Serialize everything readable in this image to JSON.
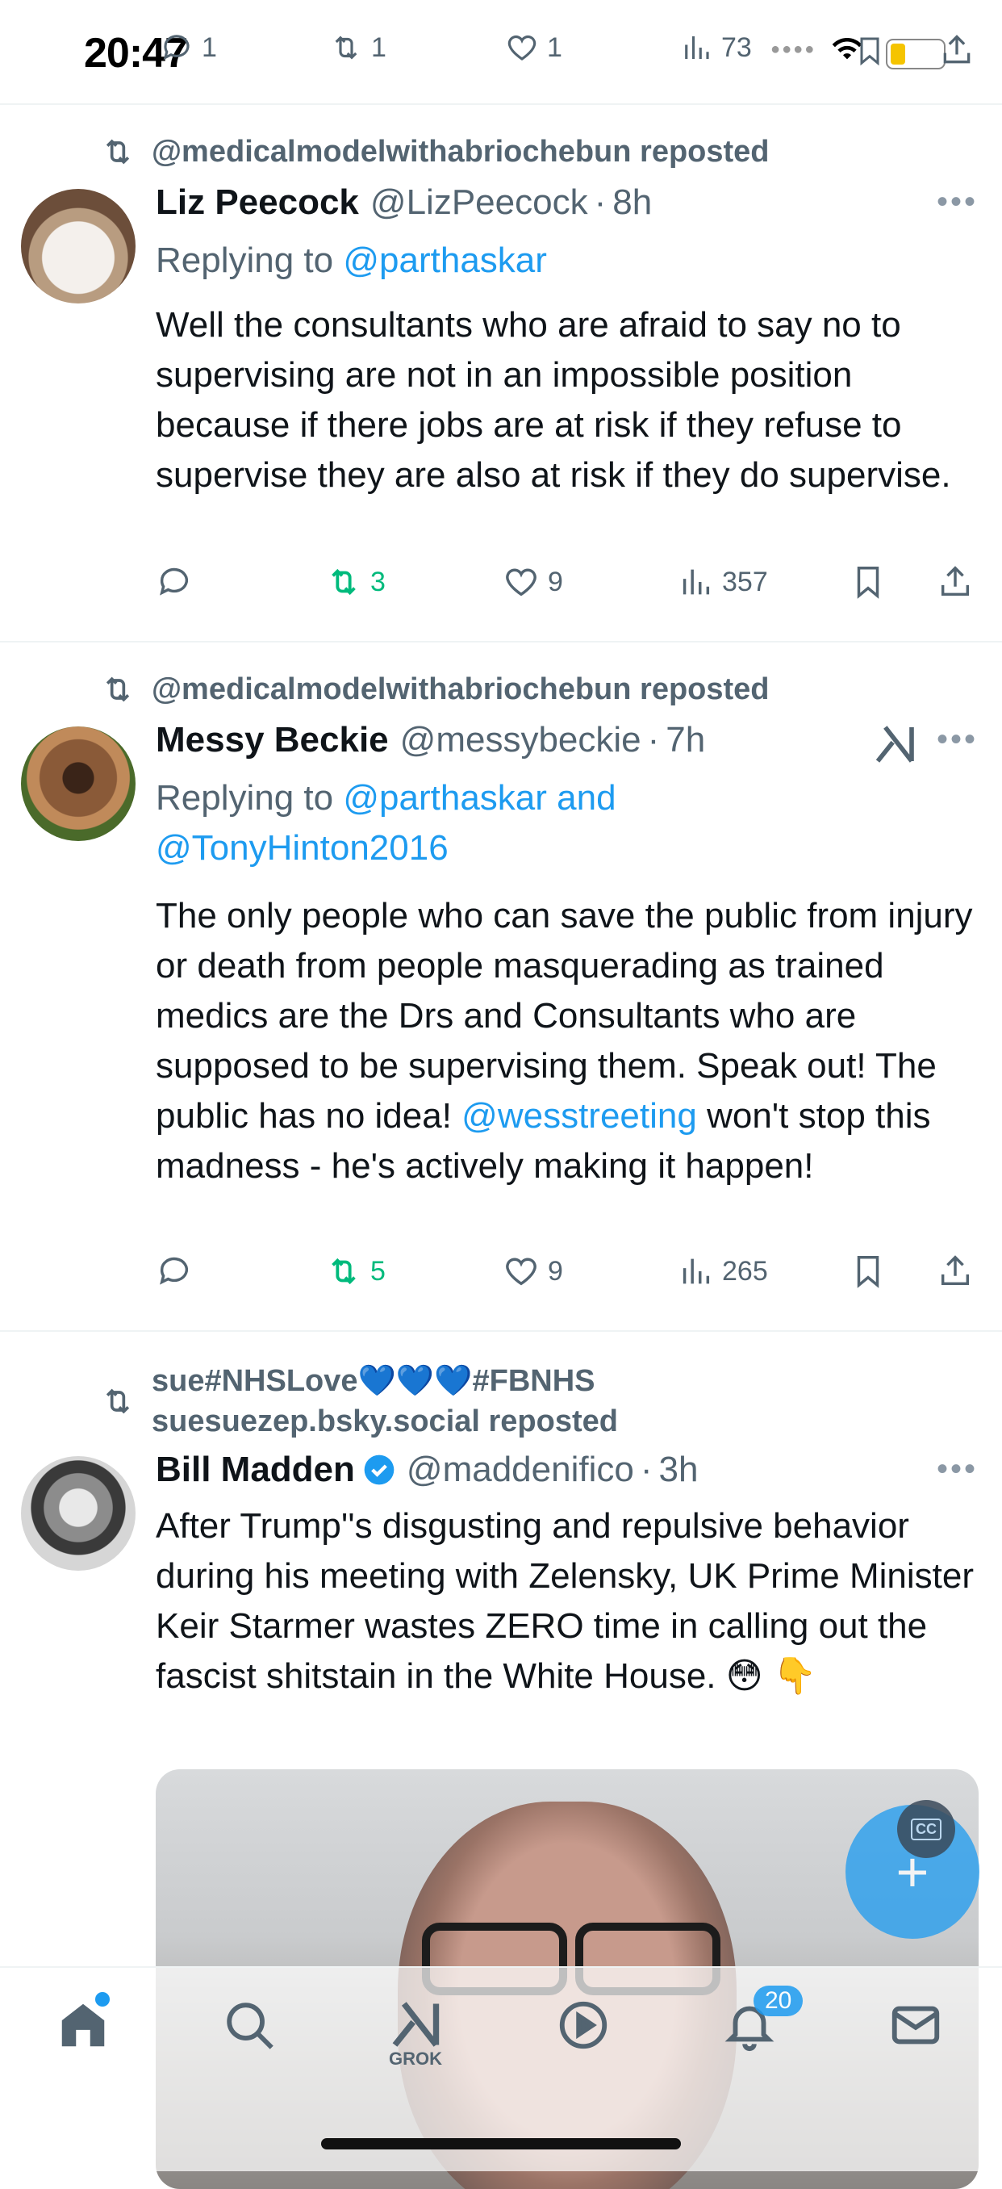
{
  "status": {
    "time": "20:47"
  },
  "top_actions": {
    "replies": "1",
    "reposts": "1",
    "likes": "1",
    "views": "73"
  },
  "posts": [
    {
      "repost_by": "@medicalmodelwithabriochebun reposted",
      "name": "Liz Peecock",
      "handle": "@LizPeecock",
      "time": "8h",
      "replying_prefix": "Replying to ",
      "replying_to": "@parthaskar",
      "text": "Well the consultants who are afraid to say no to supervising are not in an impossible position because if there jobs are at risk if they refuse to supervise they are also at risk if they do supervise.",
      "reposts": "3",
      "likes": "9",
      "views": "357"
    },
    {
      "repost_by": "@medicalmodelwithabriochebun reposted",
      "name": "Messy Beckie",
      "handle": "@messybeckie",
      "time": "7h",
      "replying_prefix": "Replying to ",
      "replying_to": "@parthaskar and",
      "replying_to_2": "@TonyHinton2016",
      "text_1": "The only people who can save the public from injury or death from people masquerading as trained medics are the Drs and Consultants who are supposed to be supervising them. Speak out! The public has no idea!",
      "mention": "@wesstreeting",
      "text_2": " won't stop this madness - he's actively making it happen!",
      "reposts": "5",
      "likes": "9",
      "views": "265"
    },
    {
      "repost_by_line1": "sue#NHSLove💙💙💙#FBNHS",
      "repost_by_line2": "suesuezep.bsky.social reposted",
      "name": "Bill Madden",
      "handle": "@maddenifico",
      "time": "3h",
      "text": "After Trump''s disgusting and repulsive behavior during his meeting with Zelensky, UK Prime Minister Keir Starmer wastes ZERO time in calling out the fascist shitstain in the White House. 😳 👇"
    }
  ],
  "video": {
    "cc_label": "CC"
  },
  "nav": {
    "grok_label": "GROK",
    "notifications_badge": "20"
  },
  "colors": {
    "accent": "#1d9bf0",
    "repost_green": "#00ba7c",
    "muted": "#536471"
  }
}
